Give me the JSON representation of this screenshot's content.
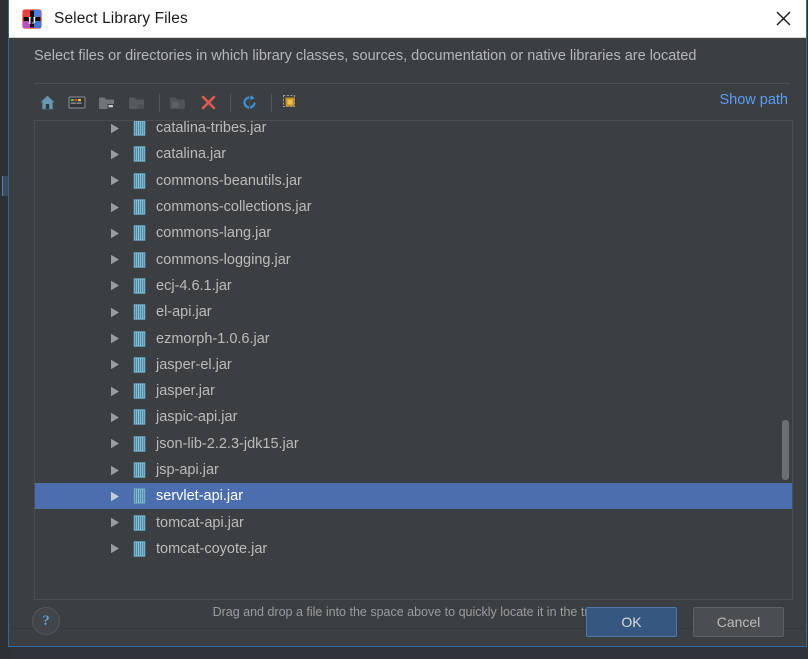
{
  "window": {
    "title": "Select Library Files",
    "app_icon": "intellij-idea-icon",
    "close_icon": "close-icon"
  },
  "dialog": {
    "description": "Select files or directories in which library classes, sources, documentation or native libraries are located",
    "hint": "Drag and drop a file into the space above to quickly locate it in the tree"
  },
  "toolbar": {
    "show_path_label": "Show path",
    "buttons": [
      {
        "name": "home-icon",
        "title": "Home",
        "enabled": true
      },
      {
        "name": "desktop-icon",
        "title": "Desktop",
        "enabled": true
      },
      {
        "name": "folder-new-icon",
        "title": "New Folder",
        "enabled": true
      },
      {
        "name": "folder-icon",
        "title": "Folder",
        "enabled": false
      },
      {
        "name": "folder-up-icon",
        "title": "Up",
        "enabled": false
      },
      {
        "name": "delete-icon",
        "title": "Delete",
        "enabled": true
      },
      {
        "name": "refresh-icon",
        "title": "Refresh",
        "enabled": true
      },
      {
        "name": "hidden-files-icon",
        "title": "Show Hidden Files",
        "enabled": true
      }
    ]
  },
  "tree": {
    "rows": [
      {
        "label": "catalina-tribes.jar",
        "selected": false
      },
      {
        "label": "catalina.jar",
        "selected": false
      },
      {
        "label": "commons-beanutils.jar",
        "selected": false
      },
      {
        "label": "commons-collections.jar",
        "selected": false
      },
      {
        "label": "commons-lang.jar",
        "selected": false
      },
      {
        "label": "commons-logging.jar",
        "selected": false
      },
      {
        "label": "ecj-4.6.1.jar",
        "selected": false
      },
      {
        "label": "el-api.jar",
        "selected": false
      },
      {
        "label": "ezmorph-1.0.6.jar",
        "selected": false
      },
      {
        "label": "jasper-el.jar",
        "selected": false
      },
      {
        "label": "jasper.jar",
        "selected": false
      },
      {
        "label": "jaspic-api.jar",
        "selected": false
      },
      {
        "label": "json-lib-2.2.3-jdk15.jar",
        "selected": false
      },
      {
        "label": "jsp-api.jar",
        "selected": false
      },
      {
        "label": "servlet-api.jar",
        "selected": true
      },
      {
        "label": "tomcat-api.jar",
        "selected": false
      },
      {
        "label": "tomcat-coyote.jar",
        "selected": false
      }
    ]
  },
  "footer": {
    "help_label": "?",
    "ok_label": "OK",
    "cancel_label": "Cancel"
  },
  "colors": {
    "accent_blue": "#4b6eaf",
    "link_blue": "#589df6",
    "ok_button": "#365880",
    "dialog_bg": "#3c3f41",
    "border_blue": "#2f6a9b"
  }
}
